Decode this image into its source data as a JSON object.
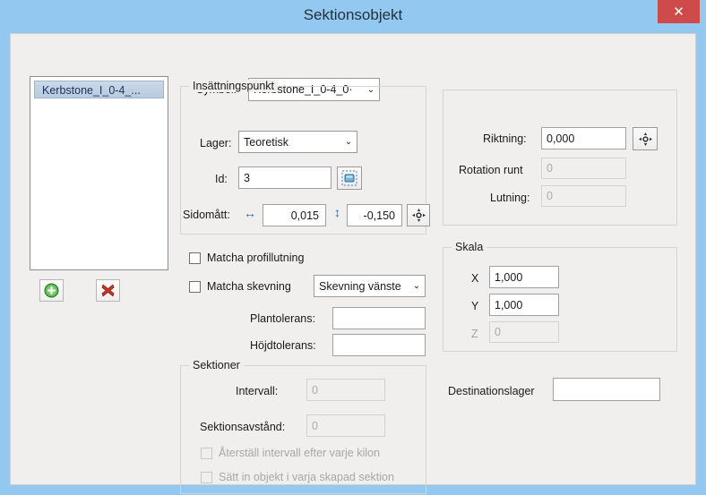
{
  "window": {
    "title": "Sektionsobjekt",
    "close_label": "✕",
    "close_icon": "close-icon",
    "titlebar_color": "#93c9f0",
    "close_button_color": "#cf4b4b",
    "client_color": "#f0efee"
  },
  "object_list": {
    "items": [
      {
        "label": "Kerbstone_I_0-4_...",
        "selected": true
      }
    ],
    "add_button": {
      "icon": "plus-circle-icon",
      "glyph": "+",
      "color": "#3fa23f"
    },
    "delete_button": {
      "icon": "red-x-icon",
      "glyph": "✖",
      "color": "#c0392b"
    }
  },
  "symbol": {
    "label": "Symbol:",
    "value": "Kerbstone_I_0-4_0·",
    "arrow": "⌄"
  },
  "insertion_point": {
    "title": "Insättningspunkt",
    "layer_label": "Lager:",
    "layer_value": "Teoretisk",
    "layer_arrow": "⌄",
    "id_label": "Id:",
    "id_value": "3",
    "pick_button_icon": "pick-object-icon",
    "side_label": "Sidomått:",
    "horizontal_icon": "horizontal-double-arrow-icon",
    "horizontal_glyph": "↔",
    "horizontal_value": "0,015",
    "vertical_icon": "vertical-double-arrow-icon",
    "vertical_glyph": "↕",
    "vertical_value": "-0,150",
    "snap_button_icon": "crosshair-icon"
  },
  "direction": {
    "riktning_label": "Riktning:",
    "riktning_value": "0,000",
    "riktning_pick_icon": "crosshair-icon",
    "rotation_label": "Rotation runt",
    "rotation_value": "0",
    "rotation_enabled": false,
    "lutning_label": "Lutning:",
    "lutning_value": "0",
    "lutning_enabled": false
  },
  "match_options": {
    "profile_slope": {
      "label": "Matcha profillutning",
      "checked": false
    },
    "superelevation": {
      "label": "Matcha skevning",
      "checked": false
    },
    "superelevation_combo": {
      "value": "Skevning vänste",
      "arrow": "⌄"
    },
    "plan_tolerance": {
      "label": "Plantolerans:",
      "value": ""
    },
    "height_tolerance": {
      "label": "Höjdtolerans:",
      "value": ""
    }
  },
  "scale": {
    "title": "Skala",
    "x_label": "X",
    "x_value": "1,000",
    "y_label": "Y",
    "y_value": "1,000",
    "z_label": "Z",
    "z_value": "0",
    "z_enabled": false
  },
  "sections": {
    "title": "Sektioner",
    "interval_label": "Intervall:",
    "interval_value": "0",
    "interval_enabled": false,
    "spacing_label": "Sektionsavstånd:",
    "spacing_value": "0",
    "spacing_enabled": false,
    "reset_interval": {
      "label": "Återställ intervall efter varje kilon",
      "checked": false,
      "enabled": false
    },
    "insert_object": {
      "label": "Sätt in objekt i varja skapad sektion",
      "checked": false,
      "enabled": false
    }
  },
  "destination": {
    "label": "Destinationslager",
    "value": ""
  }
}
